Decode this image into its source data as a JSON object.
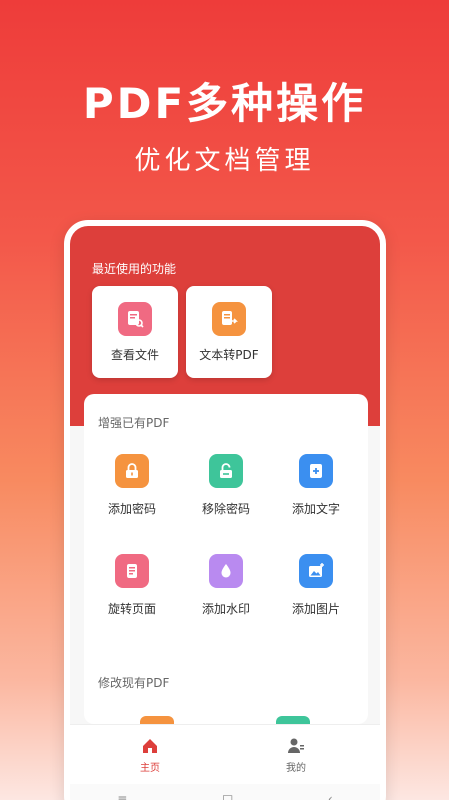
{
  "hero": {
    "title": "PDF多种操作",
    "subtitle": "优化文档管理"
  },
  "recent": {
    "label": "最近使用的功能",
    "items": [
      {
        "label": "查看文件",
        "icon": "view-file-icon",
        "color": "#f06a82"
      },
      {
        "label": "文本转PDF",
        "icon": "text-to-pdf-icon",
        "color": "#f5933f"
      }
    ]
  },
  "enhance": {
    "label": "增强已有PDF",
    "tools": [
      {
        "label": "添加密码",
        "icon": "lock-icon",
        "color": "#f5933f"
      },
      {
        "label": "移除密码",
        "icon": "unlock-icon",
        "color": "#3ec59a"
      },
      {
        "label": "添加文字",
        "icon": "add-text-icon",
        "color": "#3b8ff0"
      },
      {
        "label": "旋转页面",
        "icon": "rotate-page-icon",
        "color": "#f06a82"
      },
      {
        "label": "添加水印",
        "icon": "watermark-drop-icon",
        "color": "#b98af0"
      },
      {
        "label": "添加图片",
        "icon": "add-image-icon",
        "color": "#3b8ff0"
      }
    ]
  },
  "modify": {
    "label": "修改现有PDF"
  },
  "tabs": [
    {
      "label": "主页",
      "icon": "home-icon",
      "active": true,
      "color": "#dd3f3b"
    },
    {
      "label": "我的",
      "icon": "profile-icon",
      "active": false,
      "color": "#666666"
    }
  ],
  "system_nav": {
    "menu": "≡",
    "home": "□",
    "back": "‹"
  }
}
